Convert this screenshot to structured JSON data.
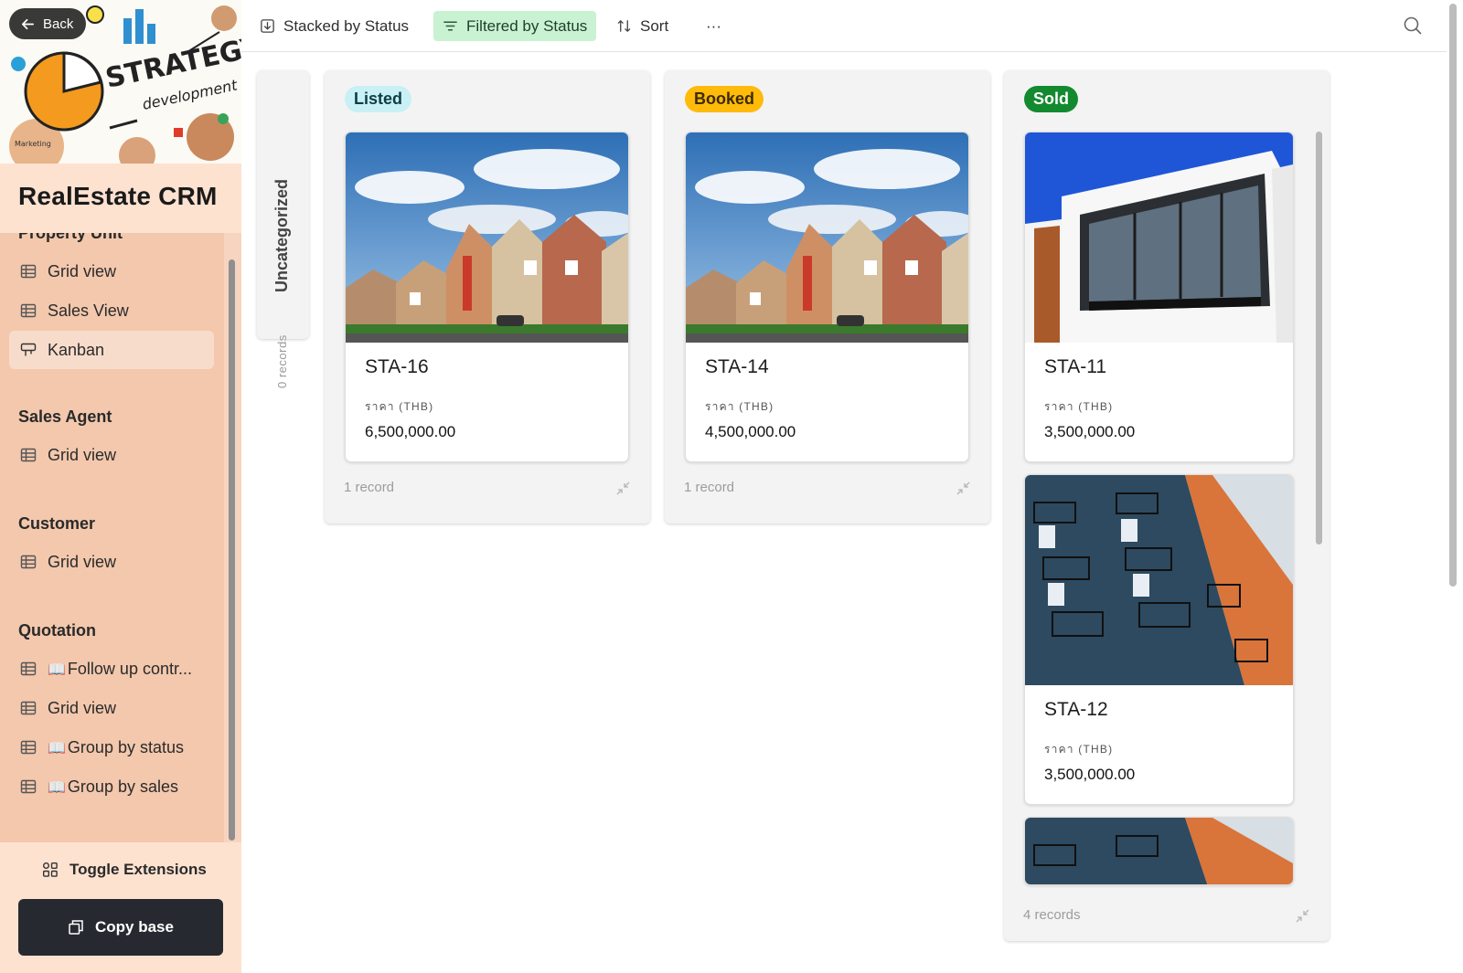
{
  "sidebar": {
    "back_label": "Back",
    "cover_text": {
      "headline": "STRATEGY",
      "sub": "development",
      "note": "Marketing"
    },
    "app_title": "RealEstate CRM",
    "sections": [
      {
        "title": "Property Unit",
        "items": [
          {
            "label": "Grid view",
            "icon": "grid-icon",
            "book": false
          },
          {
            "label": "Sales View",
            "icon": "grid-icon",
            "book": false
          },
          {
            "label": "Kanban",
            "icon": "kanban-icon",
            "book": false,
            "active": true
          }
        ]
      },
      {
        "title": "Sales Agent",
        "items": [
          {
            "label": "Grid view",
            "icon": "grid-icon",
            "book": false
          }
        ]
      },
      {
        "title": "Customer",
        "items": [
          {
            "label": "Grid view",
            "icon": "grid-icon",
            "book": false
          }
        ]
      },
      {
        "title": "Quotation",
        "items": [
          {
            "label": "Follow up contr...",
            "icon": "grid-icon",
            "book": true
          },
          {
            "label": "Grid view",
            "icon": "grid-icon",
            "book": false
          },
          {
            "label": "Group by status",
            "icon": "grid-icon",
            "book": true
          },
          {
            "label": "Group by sales",
            "icon": "grid-icon",
            "book": true
          }
        ]
      }
    ],
    "book_glyph": "📖",
    "toggle_extensions_label": "Toggle Extensions",
    "copy_base_label": "Copy base"
  },
  "toolbar": {
    "stacked_label": "Stacked by Status",
    "filtered_label": "Filtered by Status",
    "sort_label": "Sort",
    "more_label": "···"
  },
  "uncategorized": {
    "title": "Uncategorized",
    "count": "0 records"
  },
  "stacks": [
    {
      "status": "Listed",
      "badge_bg": "#c8f0f5",
      "badge_fg": "#0d3d46",
      "count": "1 record",
      "cards": [
        {
          "title": "STA-16",
          "label": "ราคา (THB)",
          "price": "6,500,000.00",
          "image": "suburban-townhouses"
        }
      ]
    },
    {
      "status": "Booked",
      "badge_bg": "#ffba0a",
      "badge_fg": "#3c2a00",
      "count": "1 record",
      "cards": [
        {
          "title": "STA-14",
          "label": "ราคา (THB)",
          "price": "4,500,000.00",
          "image": "suburban-townhouses"
        }
      ]
    },
    {
      "status": "Sold",
      "badge_bg": "#138a2f",
      "badge_fg": "#ffffff",
      "count": "4 records",
      "cards": [
        {
          "title": "STA-11",
          "label": "ราคา (THB)",
          "price": "3,500,000.00",
          "image": "modern-house"
        },
        {
          "title": "STA-12",
          "label": "ราคา (THB)",
          "price": "3,500,000.00",
          "image": "apartment-balconies"
        },
        {
          "title": "",
          "label": "",
          "price": "",
          "image": "apartment-balconies"
        }
      ]
    }
  ]
}
